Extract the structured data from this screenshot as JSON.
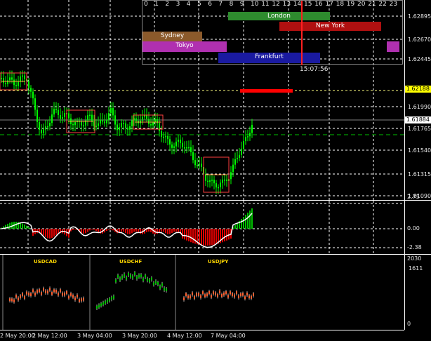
{
  "main_chart": {
    "price_ticks": [
      "1.62895",
      "1.62670",
      "1.62445",
      "1.61990",
      "1.61765",
      "1.61540",
      "1.61315",
      "1.61090"
    ],
    "current_price_tag": "1.62188",
    "bid_price_tag": "1.61884",
    "colors": {
      "candle": "#00ff00",
      "grid": "#ffffff",
      "box": "#ff4040",
      "bid_line": "#ffff00",
      "alert": "#ff0000"
    }
  },
  "sessions_panel": {
    "hours": [
      "0",
      "1",
      "2",
      "3",
      "4",
      "5",
      "6",
      "7",
      "8",
      "9",
      "10",
      "11",
      "12",
      "13",
      "14",
      "15",
      "16",
      "17",
      "18",
      "19",
      "20",
      "21",
      "22",
      "23"
    ],
    "sessions": [
      {
        "name": "London",
        "color": "#2e8b2e"
      },
      {
        "name": "New York",
        "color": "#b01010"
      },
      {
        "name": "Sydney",
        "color": "#8b5a2b"
      },
      {
        "name": "Tokyo",
        "color": "#b030b0"
      },
      {
        "name": "Frankfurt",
        "color": "#1a1aa0"
      }
    ],
    "server_time": "15:07:56"
  },
  "oscillator": {
    "ticks": [
      "2.75",
      "0.00",
      "-2.38"
    ],
    "colors": {
      "positive": "#00c000",
      "negative": "#e00000",
      "line": "#ffffff"
    }
  },
  "mini_charts": {
    "titles": [
      "USDCAD",
      "USDCHF",
      "USDJPY"
    ],
    "ticks": [
      "2030",
      "1611",
      "0"
    ]
  },
  "time_axis": [
    "2 May 20:00",
    "2 May 12:00",
    "3 May 04:00",
    "3 May 20:00",
    "4 May 12:00",
    "7 May 04:00"
  ]
}
